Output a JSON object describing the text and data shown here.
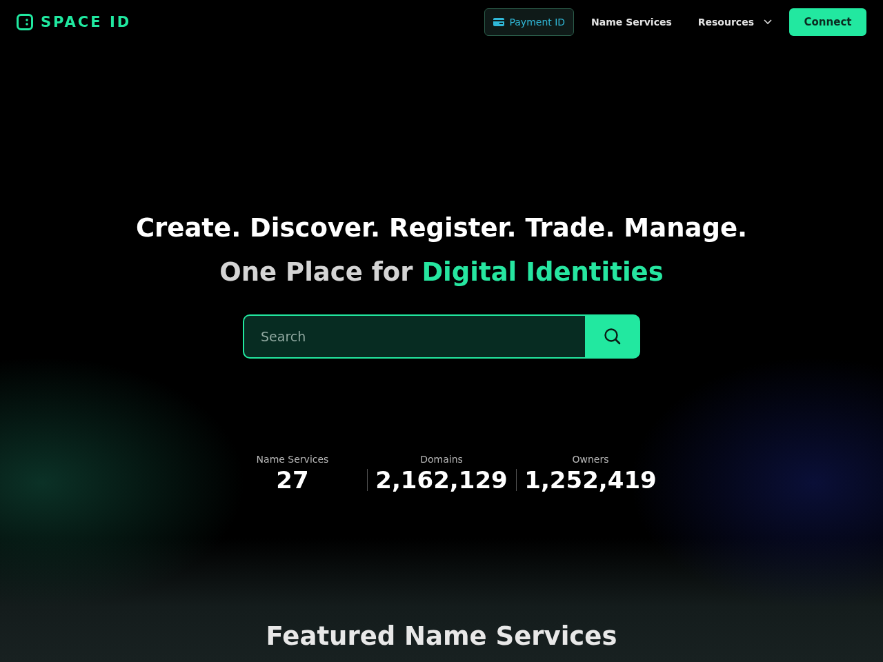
{
  "header": {
    "logo": "SPACE ID",
    "nav": [
      {
        "kind": "pill",
        "label": "Payment ID"
      },
      {
        "kind": "link",
        "label": "Name Services"
      },
      {
        "kind": "dropdown",
        "label": "Resources"
      }
    ],
    "connect": "Connect"
  },
  "hero": {
    "headline": "Create. Discover. Register. Trade. Manage.",
    "subline_lead": "One Place for",
    "subline_highlight": "Digital Identities"
  },
  "search": {
    "placeholder": "Search"
  },
  "stats": [
    {
      "label": "Name Services",
      "value": "27"
    },
    {
      "label": "Domains",
      "value": "2,162,129"
    },
    {
      "label": "Owners",
      "value": "1,252,419"
    }
  ],
  "featured": {
    "title": "Featured Name Services"
  }
}
